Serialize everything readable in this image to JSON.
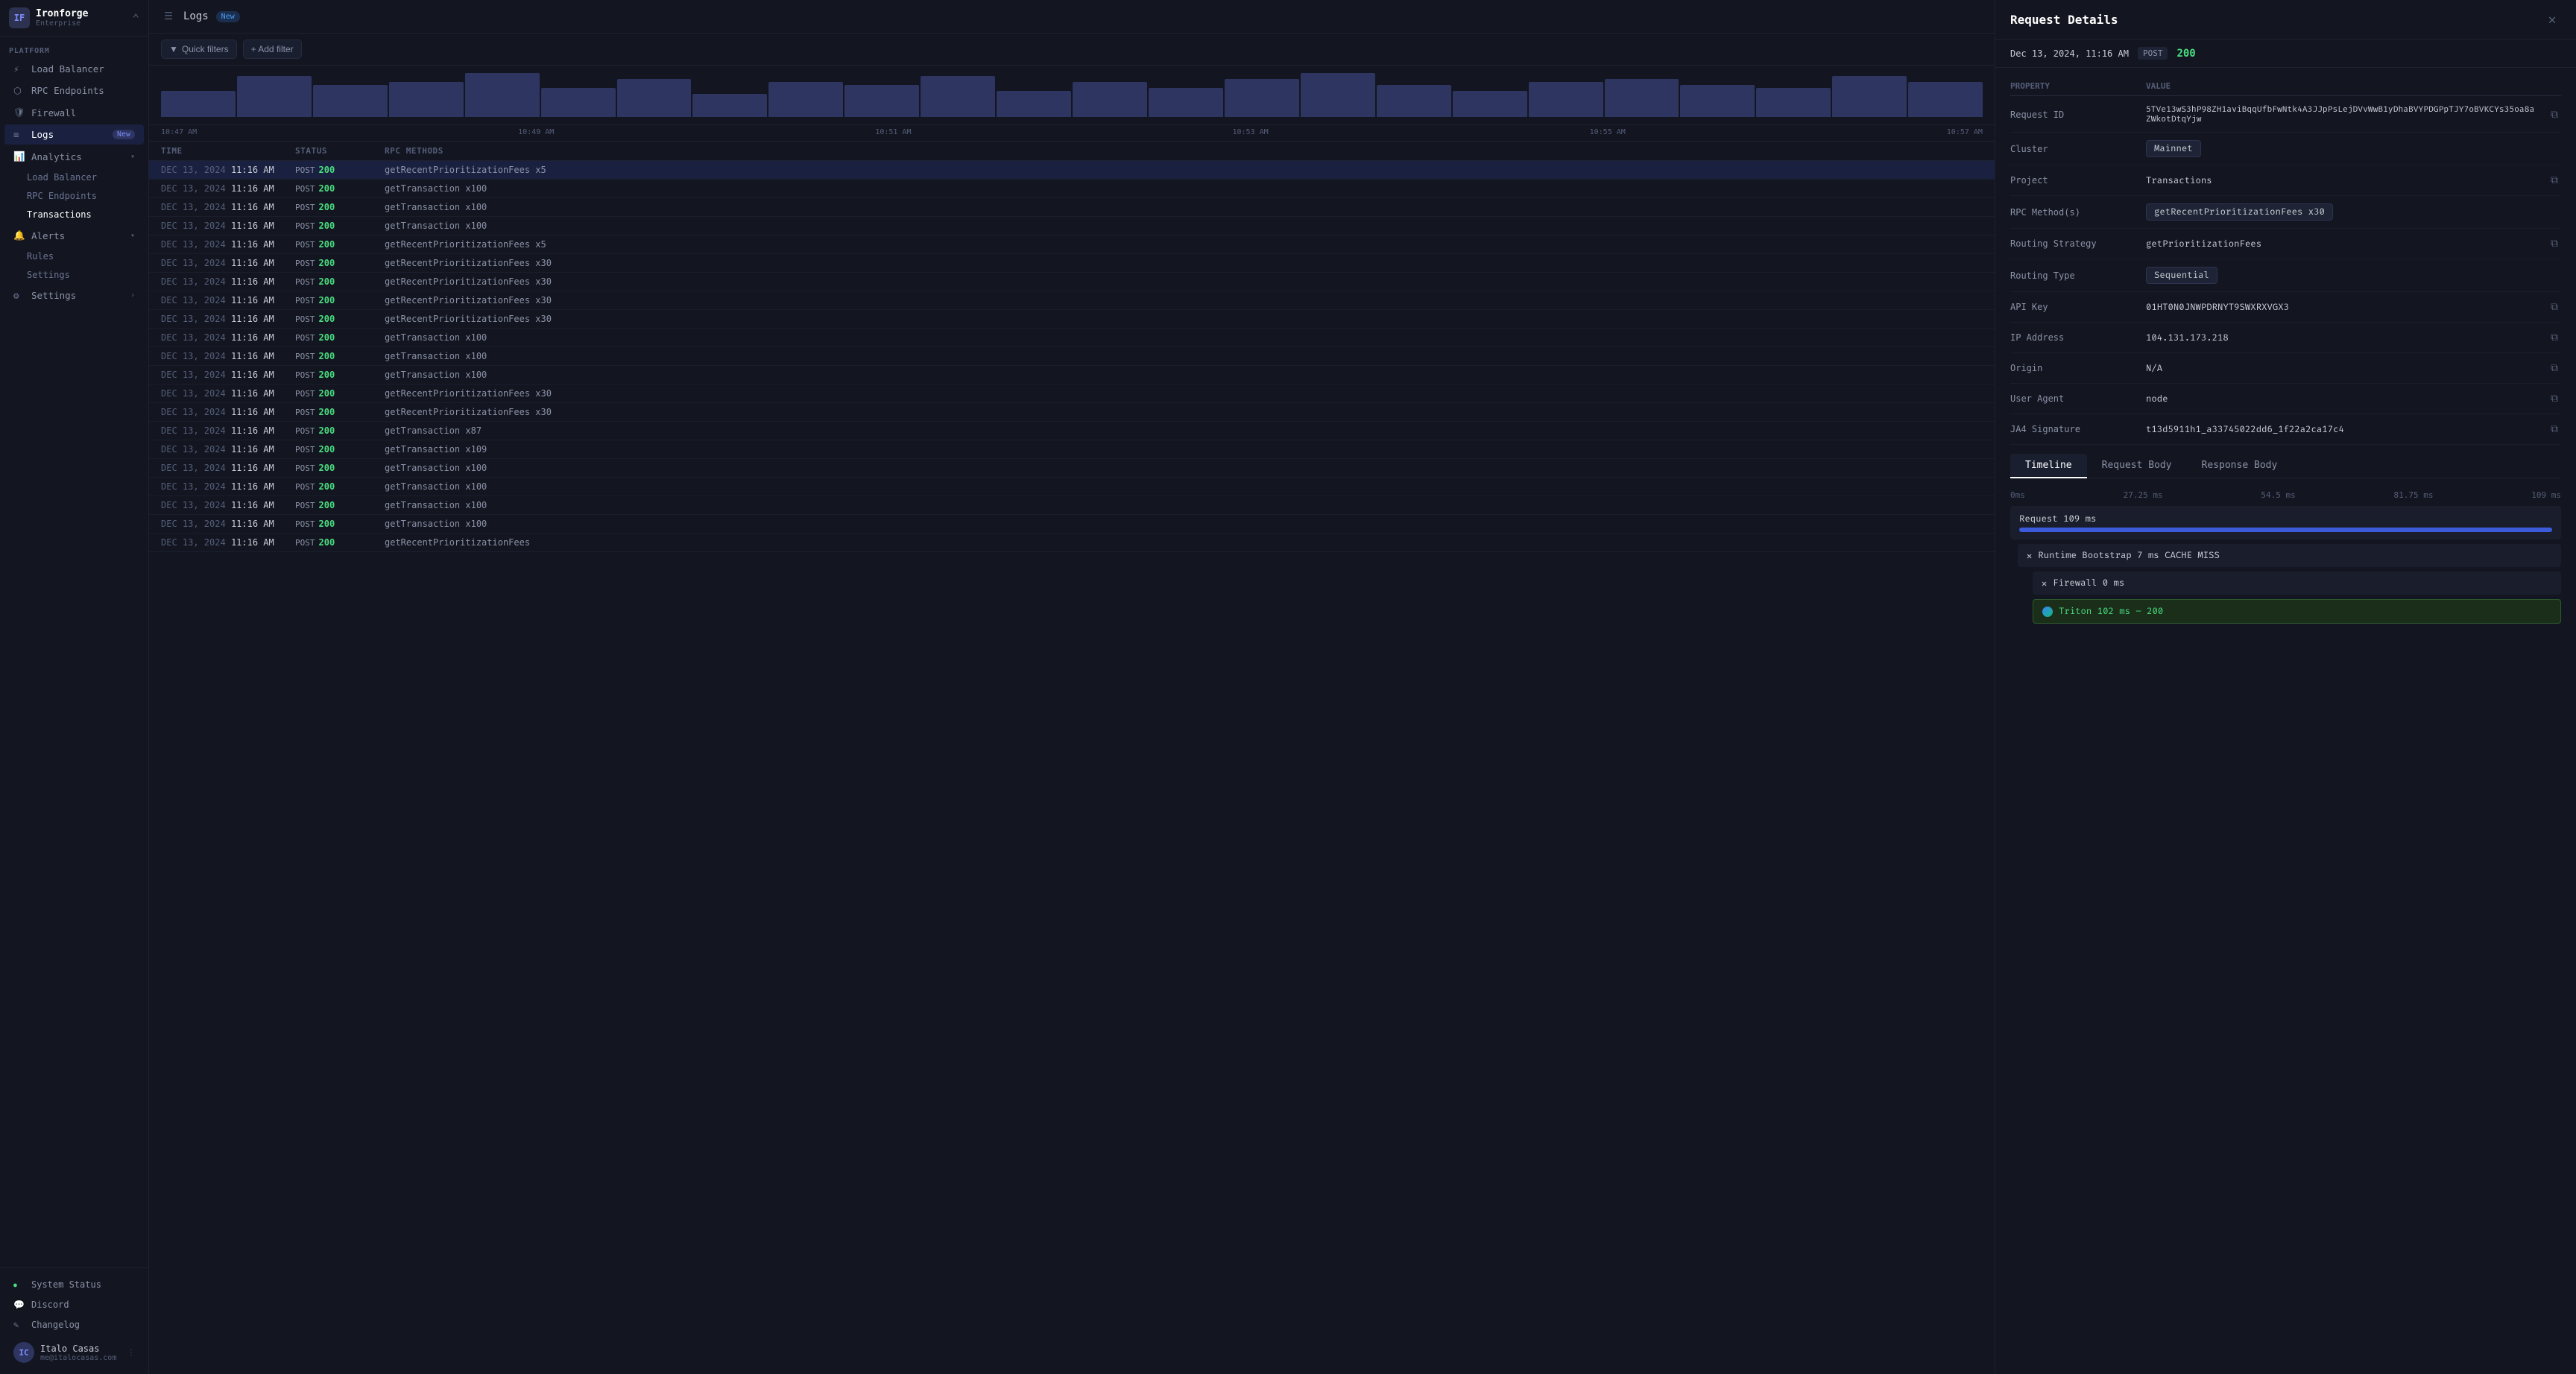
{
  "app": {
    "name": "Ironforge",
    "plan": "Enterprise",
    "logo_initials": "IF"
  },
  "sidebar": {
    "platform_label": "Platform",
    "nav_items": [
      {
        "id": "load-balancer",
        "label": "Load Balancer",
        "icon": "⚡"
      },
      {
        "id": "rpc-endpoints",
        "label": "RPC Endpoints",
        "icon": "⬡"
      },
      {
        "id": "firewall",
        "label": "Firewall",
        "icon": "🛡"
      },
      {
        "id": "logs",
        "label": "Logs",
        "icon": "📋",
        "badge": "New",
        "active": true
      },
      {
        "id": "analytics",
        "label": "Analytics",
        "icon": "📊",
        "has_arrow": true
      }
    ],
    "analytics_sub": [
      {
        "id": "load-balancer-sub",
        "label": "Load Balancer"
      },
      {
        "id": "rpc-endpoints-sub",
        "label": "RPC Endpoints"
      },
      {
        "id": "transactions-sub",
        "label": "Transactions",
        "active": true
      }
    ],
    "alerts": {
      "label": "Alerts",
      "icon": "🔔",
      "sub": [
        {
          "id": "rules",
          "label": "Rules"
        },
        {
          "id": "settings-alerts",
          "label": "Settings"
        }
      ]
    },
    "settings": {
      "label": "Settings",
      "icon": "⚙"
    },
    "footer_items": [
      {
        "id": "system-status",
        "label": "System Status",
        "icon": "●"
      },
      {
        "id": "discord",
        "label": "Discord",
        "icon": "💬"
      },
      {
        "id": "changelog",
        "label": "Changelog",
        "icon": "📝"
      }
    ],
    "user": {
      "name": "Italo Casas",
      "email": "me@italocasas.com",
      "initials": "IC"
    }
  },
  "logs": {
    "title": "Logs",
    "new_badge": "New",
    "quick_filters_label": "Quick filters",
    "add_filter_label": "+ Add filter",
    "chart_labels": [
      "10:47 AM",
      "10:49 AM",
      "10:51 AM",
      "10:53 AM",
      "10:55 AM",
      "10:57 AM"
    ],
    "chart_bars": [
      40,
      65,
      50,
      55,
      70,
      45,
      60,
      35,
      55,
      50,
      65,
      40,
      55,
      45,
      60,
      70,
      50,
      40,
      55,
      60,
      50,
      45,
      65,
      55
    ],
    "table_headers": [
      "Time",
      "Status",
      "RPC Methods"
    ],
    "rows": [
      {
        "date": "DEC 13, 2024",
        "time": "11:16 AM",
        "method": "POST",
        "status": "200",
        "rpc": "getRecentPrioritizationFees x5"
      },
      {
        "date": "DEC 13, 2024",
        "time": "11:16 AM",
        "method": "POST",
        "status": "200",
        "rpc": "getTransaction x100"
      },
      {
        "date": "DEC 13, 2024",
        "time": "11:16 AM",
        "method": "POST",
        "status": "200",
        "rpc": "getTransaction x100"
      },
      {
        "date": "DEC 13, 2024",
        "time": "11:16 AM",
        "method": "POST",
        "status": "200",
        "rpc": "getTransaction x100"
      },
      {
        "date": "DEC 13, 2024",
        "time": "11:16 AM",
        "method": "POST",
        "status": "200",
        "rpc": "getRecentPrioritizationFees x5"
      },
      {
        "date": "DEC 13, 2024",
        "time": "11:16 AM",
        "method": "POST",
        "status": "200",
        "rpc": "getRecentPrioritizationFees x30"
      },
      {
        "date": "DEC 13, 2024",
        "time": "11:16 AM",
        "method": "POST",
        "status": "200",
        "rpc": "getRecentPrioritizationFees x30"
      },
      {
        "date": "DEC 13, 2024",
        "time": "11:16 AM",
        "method": "POST",
        "status": "200",
        "rpc": "getRecentPrioritizationFees x30"
      },
      {
        "date": "DEC 13, 2024",
        "time": "11:16 AM",
        "method": "POST",
        "status": "200",
        "rpc": "getRecentPrioritizationFees x30"
      },
      {
        "date": "DEC 13, 2024",
        "time": "11:16 AM",
        "method": "POST",
        "status": "200",
        "rpc": "getTransaction x100"
      },
      {
        "date": "DEC 13, 2024",
        "time": "11:16 AM",
        "method": "POST",
        "status": "200",
        "rpc": "getTransaction x100"
      },
      {
        "date": "DEC 13, 2024",
        "time": "11:16 AM",
        "method": "POST",
        "status": "200",
        "rpc": "getTransaction x100"
      },
      {
        "date": "DEC 13, 2024",
        "time": "11:16 AM",
        "method": "POST",
        "status": "200",
        "rpc": "getRecentPrioritizationFees x30"
      },
      {
        "date": "DEC 13, 2024",
        "time": "11:16 AM",
        "method": "POST",
        "status": "200",
        "rpc": "getRecentPrioritizationFees x30"
      },
      {
        "date": "DEC 13, 2024",
        "time": "11:16 AM",
        "method": "POST",
        "status": "200",
        "rpc": "getTransaction x87"
      },
      {
        "date": "DEC 13, 2024",
        "time": "11:16 AM",
        "method": "POST",
        "status": "200",
        "rpc": "getTransaction x109"
      },
      {
        "date": "DEC 13, 2024",
        "time": "11:16 AM",
        "method": "POST",
        "status": "200",
        "rpc": "getTransaction x100"
      },
      {
        "date": "DEC 13, 2024",
        "time": "11:16 AM",
        "method": "POST",
        "status": "200",
        "rpc": "getTransaction x100"
      },
      {
        "date": "DEC 13, 2024",
        "time": "11:16 AM",
        "method": "POST",
        "status": "200",
        "rpc": "getTransaction x100"
      },
      {
        "date": "DEC 13, 2024",
        "time": "11:16 AM",
        "method": "POST",
        "status": "200",
        "rpc": "getTransaction x100"
      },
      {
        "date": "DEC 13, 2024",
        "time": "11:16 AM",
        "method": "POST",
        "status": "200",
        "rpc": "getRecentPrioritizationFees"
      }
    ]
  },
  "panel": {
    "title": "Request Details",
    "close_icon": "✕",
    "meta": {
      "date": "Dec 13, 2024, 11:16 AM",
      "method": "POST",
      "status": "200"
    },
    "details": {
      "request_id_label": "Request ID",
      "request_id_value": "5TVe13wS3hP98ZH1aviBqqUfbFwNtk4A3JJpPsLejDVvWwB1yDhaBVYPDGPpTJY7oBVKCYs35oa8aZWkotDtqYjw",
      "cluster_label": "Cluster",
      "cluster_value": "Mainnet",
      "project_label": "Project",
      "project_value": "Transactions",
      "rpc_methods_label": "RPC Method(s)",
      "rpc_methods_value": "getRecentPrioritizationFees x30",
      "routing_strategy_label": "Routing Strategy",
      "routing_strategy_value": "getPrioritizationFees",
      "routing_type_label": "Routing Type",
      "routing_type_value": "Sequential",
      "api_key_label": "API Key",
      "api_key_value": "01HT0N0JNWPDRNYT9SWXRXVGX3",
      "ip_address_label": "IP Address",
      "ip_address_value": "104.131.173.218",
      "origin_label": "Origin",
      "origin_value": "N/A",
      "user_agent_label": "User Agent",
      "user_agent_value": "node",
      "ja4_label": "JA4 Signature",
      "ja4_value": "t13d5911h1_a33745022dd6_1f22a2ca17c4"
    },
    "tabs": [
      "Timeline",
      "Request Body",
      "Response Body"
    ],
    "active_tab": "Timeline",
    "timeline": {
      "scale_labels": [
        "0ms",
        "27.25 ms",
        "54.5 ms",
        "81.75 ms",
        "109 ms"
      ],
      "request_label": "Request 109 ms",
      "request_pct": 100,
      "runtime_label": "Runtime Bootstrap 7 ms CACHE MISS",
      "runtime_pct": 6.4,
      "firewall_label": "Firewall 0 ms",
      "firewall_pct": 0.5,
      "triton_label": "Triton 102 ms – 200",
      "triton_pct": 93.5
    }
  }
}
